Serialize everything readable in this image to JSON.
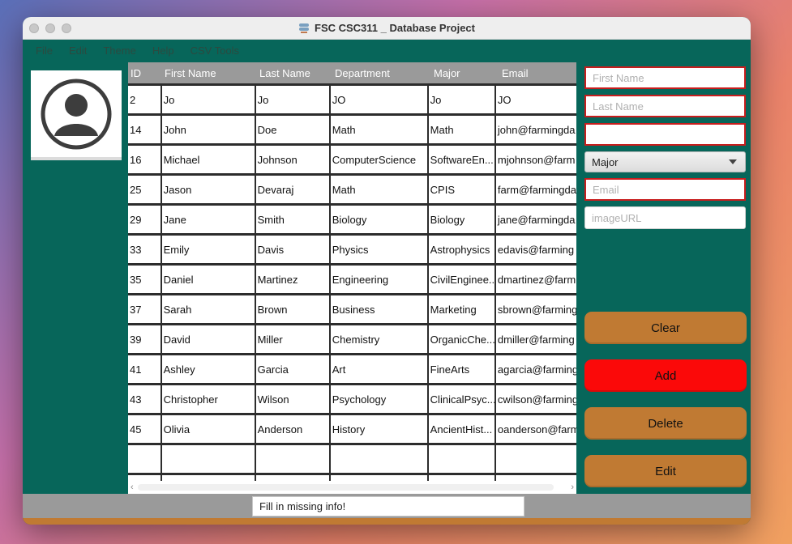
{
  "window": {
    "title": "FSC CSC311 _ Database Project"
  },
  "menu": [
    "File",
    "Edit",
    "Theme",
    "Help",
    "CSV Tools"
  ],
  "table": {
    "columns": [
      "ID",
      "First Name",
      "Last Name",
      "Department",
      "Major",
      "Email"
    ],
    "rows": [
      [
        "2",
        "Jo",
        "Jo",
        "JO",
        "Jo",
        "JO"
      ],
      [
        "14",
        "John",
        "Doe",
        "Math",
        "Math",
        "john@farmingda"
      ],
      [
        "16",
        "Michael",
        "Johnson",
        "ComputerScience",
        "SoftwareEn...",
        "mjohnson@farm"
      ],
      [
        "25",
        "Jason",
        "Devaraj",
        "Math",
        "CPIS",
        "farm@farmingda"
      ],
      [
        "29",
        "Jane",
        "Smith",
        "Biology",
        "Biology",
        "jane@farmingda"
      ],
      [
        "33",
        "Emily",
        "Davis",
        "Physics",
        "Astrophysics",
        "edavis@farming"
      ],
      [
        "35",
        "Daniel",
        "Martinez",
        "Engineering",
        "CivilEnginee...",
        "dmartinez@farm"
      ],
      [
        "37",
        "Sarah",
        "Brown",
        "Business",
        "Marketing",
        "sbrown@farming"
      ],
      [
        "39",
        "David",
        "Miller",
        "Chemistry",
        "OrganicChe...",
        "dmiller@farming"
      ],
      [
        "41",
        "Ashley",
        "Garcia",
        "Art",
        "FineArts",
        "agarcia@farming"
      ],
      [
        "43",
        "Christopher",
        "Wilson",
        "Psychology",
        "ClinicalPsyc...",
        "cwilson@farming"
      ],
      [
        "45",
        "Olivia",
        "Anderson",
        "History",
        "AncientHist...",
        "oanderson@farm"
      ],
      [
        "",
        "",
        "",
        "",
        "",
        ""
      ],
      [
        "",
        "",
        "",
        "",
        "",
        ""
      ]
    ]
  },
  "form": {
    "first_name_placeholder": "First Name",
    "last_name_placeholder": "Last Name",
    "department_placeholder": "",
    "major_selected": "Major",
    "email_placeholder": "Email",
    "image_url_placeholder": "imageURL"
  },
  "buttons": {
    "clear": "Clear",
    "add": "Add",
    "delete": "Delete",
    "edit": "Edit"
  },
  "status": {
    "message": "Fill in missing info!"
  },
  "colors": {
    "background": "#07665a",
    "button": "#c07a33",
    "add_button": "#fb0909",
    "error_border": "#c81d1d"
  }
}
